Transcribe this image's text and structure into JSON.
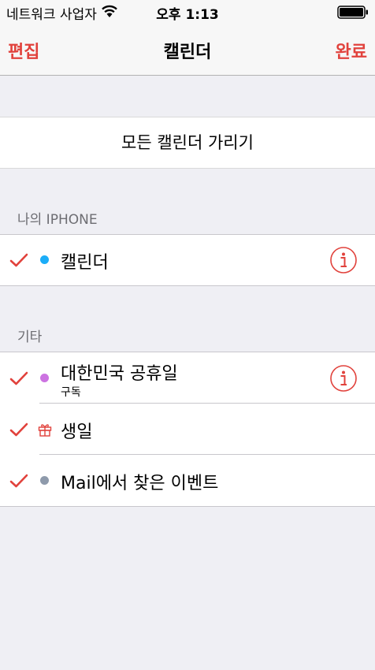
{
  "status_bar": {
    "carrier": "네트워크 사업자",
    "time": "오후 1:13"
  },
  "nav": {
    "edit": "편집",
    "title": "캘린더",
    "done": "완료"
  },
  "hide_all": "모든 캘린더 가리기",
  "sections": [
    {
      "header": "나의 IPHONE",
      "items": [
        {
          "label": "캘린더",
          "color": "#1badf8",
          "checked": true,
          "info": true
        }
      ]
    },
    {
      "header": "기타",
      "items": [
        {
          "label": "대한민국 공휴일",
          "sublabel": "구독",
          "color": "#cc73e1",
          "checked": true,
          "info": true
        },
        {
          "label": "생일",
          "icon": "gift-icon",
          "color": "#e1423c",
          "checked": true,
          "info": false
        },
        {
          "label": "Mail에서 찾은 이벤트",
          "color": "#8e9aab",
          "checked": true,
          "info": false
        }
      ]
    }
  ],
  "colors": {
    "accent": "#e1423c"
  }
}
